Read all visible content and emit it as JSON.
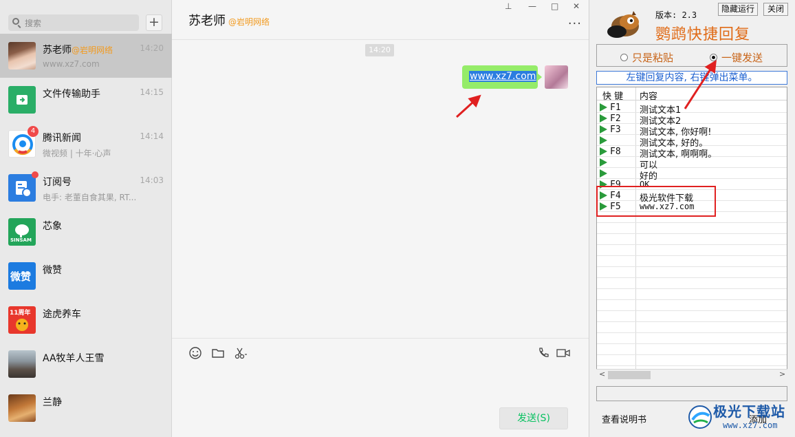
{
  "sidebar": {
    "search_placeholder": "搜索",
    "add_label": "+",
    "items": [
      {
        "name": "苏老师",
        "tag": "@岩明网络",
        "time": "14:20",
        "preview": "www.xz7.com",
        "active": true
      },
      {
        "name": "文件传输助手",
        "tag": "",
        "time": "14:15",
        "preview": ""
      },
      {
        "name": "腾讯新闻",
        "tag": "",
        "time": "14:14",
        "preview": "微视频 | 十年·心声",
        "badge": "4"
      },
      {
        "name": "订阅号",
        "tag": "",
        "time": "14:03",
        "preview": "电手: 老董自食其果, RT..."
      },
      {
        "name": "芯象",
        "tag": "",
        "time": "",
        "preview": ""
      },
      {
        "name": "微赞",
        "tag": "",
        "time": "",
        "preview": ""
      },
      {
        "name": "途虎养车",
        "tag": "",
        "time": "",
        "preview": ""
      },
      {
        "name": "AA牧羊人王雪",
        "tag": "",
        "time": "",
        "preview": ""
      },
      {
        "name": "兰静",
        "tag": "",
        "time": "",
        "preview": ""
      }
    ],
    "avatar_labels": {
      "xinxiang": "SINSAM",
      "weizan": "微赞",
      "tuhu": "11周年"
    }
  },
  "chat": {
    "title": "苏老师",
    "title_tag": "@岩明网络",
    "time_chip": "14:20",
    "message": "www.xz7.com",
    "more_label": "···",
    "send_label": "发送(S)",
    "window_controls": [
      "⊥",
      "—",
      "□",
      "✕"
    ]
  },
  "quickreply": {
    "version": "版本: 2.3",
    "title": "鹦鹉快捷回复",
    "hide_label": "隐藏运行",
    "close_label": "关闭",
    "radio_paste": "只是粘贴",
    "radio_send": "一键发送",
    "hint": "左键回复内容, 右键弹出菜单。",
    "col_key": "快 键",
    "col_content": "内容",
    "rows": [
      {
        "key": "F1",
        "content": "测试文本1"
      },
      {
        "key": "F2",
        "content": "测试文本2"
      },
      {
        "key": "F3",
        "content": "测试文本, 你好啊!"
      },
      {
        "key": "",
        "content": "测试文本, 好的。"
      },
      {
        "key": "F8",
        "content": "测试文本, 啊啊啊。"
      },
      {
        "key": "",
        "content": "可以"
      },
      {
        "key": "",
        "content": "好的"
      },
      {
        "key": "F9",
        "content": "OK"
      },
      {
        "key": "F4",
        "content": "极光软件下载"
      },
      {
        "key": "F5",
        "content": "www.xz7.com"
      }
    ],
    "scroll_left": "<",
    "scroll_right": ">",
    "help_label": "查看说明书",
    "add_label": "添加"
  },
  "watermark": {
    "title": "极光下载站",
    "url": "www.xz7.com"
  },
  "colors": {
    "accent_orange": "#f29a1f",
    "wechat_green": "#07c160",
    "bubble_green": "#95ec69",
    "annotation_red": "#e02020"
  }
}
